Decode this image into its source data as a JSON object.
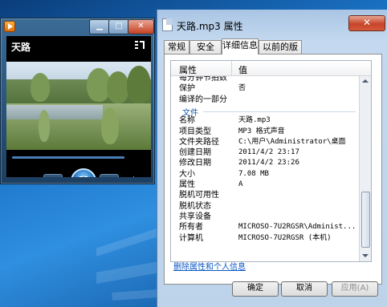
{
  "player": {
    "video_title": "天路",
    "progress": 0.0
  },
  "dialog": {
    "title": "天路.mp3 属性",
    "close": "✕",
    "tabs": [
      "常规",
      "安全",
      "详细信息",
      "以前的版本"
    ],
    "active_tab": 2,
    "columns": [
      "属性",
      "值"
    ],
    "rows": [
      {
        "k": "每分钟节拍数",
        "v": ""
      },
      {
        "k": "保护",
        "v": "否"
      },
      {
        "k": "编译的一部分",
        "v": ""
      },
      {
        "group": "文件"
      },
      {
        "k": "名称",
        "v": "天路.mp3"
      },
      {
        "k": "项目类型",
        "v": "MP3 格式声音"
      },
      {
        "k": "文件夹路径",
        "v": "C:\\用户\\Administrator\\桌面"
      },
      {
        "k": "创建日期",
        "v": "2011/4/2 23:17"
      },
      {
        "k": "修改日期",
        "v": "2011/4/2 23:26"
      },
      {
        "k": "大小",
        "v": "7.08 MB"
      },
      {
        "k": "属性",
        "v": "A"
      },
      {
        "k": "脱机可用性",
        "v": ""
      },
      {
        "k": "脱机状态",
        "v": ""
      },
      {
        "k": "共享设备",
        "v": ""
      },
      {
        "k": "所有者",
        "v": "MICROSO-7U2RGSR\\Administ..."
      },
      {
        "k": "计算机",
        "v": "MICROSO-7U2RGSR (本机)"
      }
    ],
    "remove_link": "删除属性和个人信息",
    "ok": "确定",
    "cancel": "取消",
    "apply": "应用(A)"
  }
}
